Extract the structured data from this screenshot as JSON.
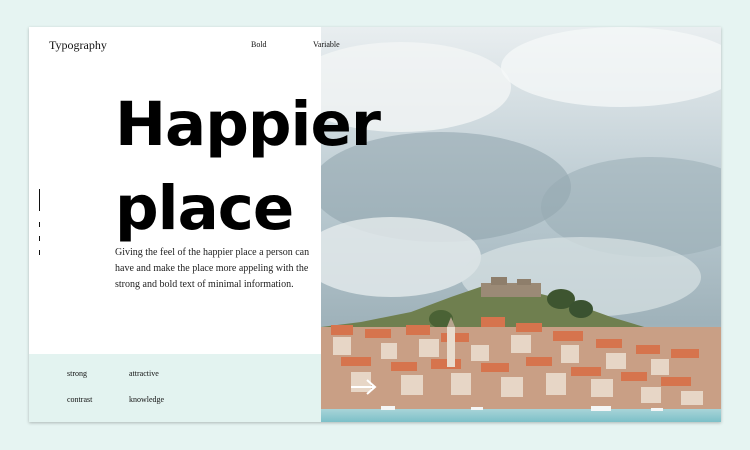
{
  "header": {
    "brand": "Typography",
    "nav": [
      "Bold",
      "Variable"
    ]
  },
  "hero": {
    "headline_line1": "Happier",
    "headline_line2": "place",
    "description": "Giving the feel of the happier place a person can have and make the place more appeling with the strong and bold text of minimal information."
  },
  "tags": [
    "strong",
    "attractive",
    "contrast",
    "knowledge"
  ],
  "icons": {
    "next": "arrow-right-icon"
  },
  "colors": {
    "page_background": "#e6f4f2",
    "panel": "#e3f3f0",
    "text": "#000000"
  }
}
